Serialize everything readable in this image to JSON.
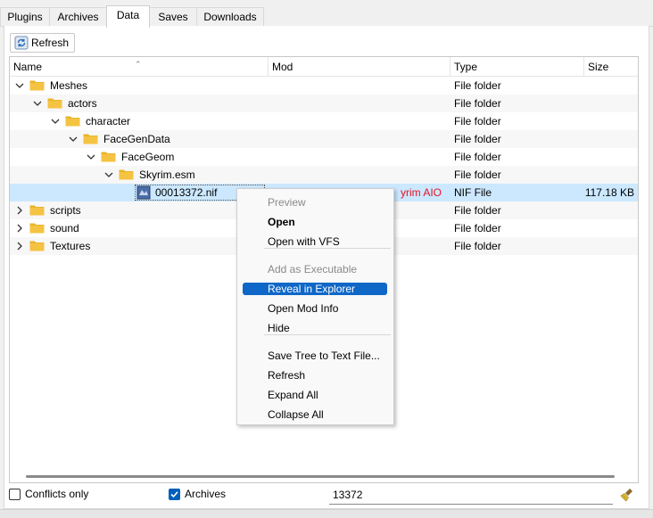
{
  "tabs": [
    {
      "label": "Plugins",
      "active": false
    },
    {
      "label": "Archives",
      "active": false
    },
    {
      "label": "Data",
      "active": true
    },
    {
      "label": "Saves",
      "active": false
    },
    {
      "label": "Downloads",
      "active": false
    }
  ],
  "toolbar": {
    "refresh_label": "Refresh"
  },
  "columns": {
    "name": "Name",
    "mod": "Mod",
    "type": "Type",
    "size": "Size"
  },
  "tree": [
    {
      "name": "Meshes",
      "mod": "",
      "type": "File folder",
      "size": "",
      "depth": 0,
      "expanded": true,
      "kind": "folder"
    },
    {
      "name": "actors",
      "mod": "",
      "type": "File folder",
      "size": "",
      "depth": 1,
      "expanded": true,
      "kind": "folder"
    },
    {
      "name": "character",
      "mod": "",
      "type": "File folder",
      "size": "",
      "depth": 2,
      "expanded": true,
      "kind": "folder"
    },
    {
      "name": "FaceGenData",
      "mod": "",
      "type": "File folder",
      "size": "",
      "depth": 3,
      "expanded": true,
      "kind": "folder"
    },
    {
      "name": "FaceGeom",
      "mod": "",
      "type": "File folder",
      "size": "",
      "depth": 4,
      "expanded": true,
      "kind": "folder"
    },
    {
      "name": "Skyrim.esm",
      "mod": "",
      "type": "File folder",
      "size": "",
      "depth": 5,
      "expanded": true,
      "kind": "folder"
    },
    {
      "name": "00013372.nif",
      "mod": "yrim AIO",
      "type": "NIF File",
      "size": "117.18 KB",
      "depth": 6,
      "kind": "file",
      "selected": true
    },
    {
      "name": "scripts",
      "mod": "",
      "type": "File folder",
      "size": "",
      "depth": 0,
      "expanded": false,
      "kind": "folder"
    },
    {
      "name": "sound",
      "mod": "",
      "type": "File folder",
      "size": "",
      "depth": 0,
      "expanded": false,
      "kind": "folder"
    },
    {
      "name": "Textures",
      "mod": "",
      "type": "File folder",
      "size": "",
      "depth": 0,
      "expanded": false,
      "kind": "folder"
    }
  ],
  "context_menu": {
    "items": [
      {
        "label": "Preview",
        "state": "disabled"
      },
      {
        "label": "Open",
        "state": "bold"
      },
      {
        "label": "Open with VFS",
        "state": "normal"
      },
      {
        "label": "Add as Executable",
        "state": "disabled"
      },
      {
        "label": "Reveal in Explorer",
        "state": "highlighted"
      },
      {
        "label": "Open Mod Info",
        "state": "normal"
      },
      {
        "label": "Hide",
        "state": "normal"
      },
      {
        "label": "Save Tree to Text File...",
        "state": "normal"
      },
      {
        "label": "Refresh",
        "state": "normal"
      },
      {
        "label": "Expand All",
        "state": "normal"
      },
      {
        "label": "Collapse All",
        "state": "normal"
      }
    ]
  },
  "bottom": {
    "conflicts_label": "Conflicts only",
    "conflicts_checked": false,
    "archives_label": "Archives",
    "archives_checked": true,
    "filter_value": "13372"
  },
  "colors": {
    "accent": "#005fb8",
    "selection": "#cce8ff",
    "menu_highlight": "#0f67c7",
    "mod_conflict_text": "#e81123",
    "folder": "#f5c342"
  },
  "icons": {
    "refresh": "refresh-icon",
    "folder": "folder-icon",
    "file": "nif-file-icon",
    "clear": "broom-icon"
  }
}
